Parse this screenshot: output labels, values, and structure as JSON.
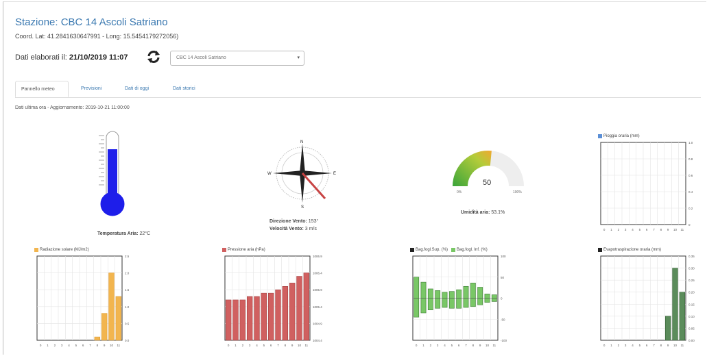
{
  "header": {
    "title": "Stazione: CBC 14 Ascoli Satriano",
    "coords": "Coord. Lat: 41.2841630647991 - Long: 15.5454179272056)",
    "dati_label": "Dati elaborati il:",
    "dati_value": "21/10/2019 11:07",
    "station_select": "CBC 14 Ascoli Satriano"
  },
  "tabs": [
    {
      "label": "Pannello meteo"
    },
    {
      "label": "Previsioni"
    },
    {
      "label": "Dati di oggi"
    },
    {
      "label": "Dati storici"
    }
  ],
  "updated_text": "Dati ultima ora - Aggiornamento: 2019-10-21 11:00:00",
  "widgets": {
    "temperature": {
      "label": "Temperatura Aria:",
      "value": "22°C"
    },
    "wind": {
      "dir_label": "Direzione Vento:",
      "dir_value": "153°",
      "speed_label": "Velocità Vento:",
      "speed_value": "3 m/s",
      "n": "N",
      "s": "S",
      "e": "E",
      "w": "W"
    },
    "humidity": {
      "label": "Umidità aria:",
      "value": "53.1%",
      "gauge_value": "50",
      "gauge_min": "0%",
      "gauge_max": "100%",
      "fill_fraction": 0.53
    }
  },
  "colors": {
    "thermo": "#1e1eea",
    "rad": "#f2b54f",
    "press": "#d06060",
    "soil": "#79c766",
    "evap": "#5b8c5b",
    "rain": "#5b8fd6"
  },
  "chart_data": [
    {
      "id": "rain",
      "type": "bar",
      "legend": "Pioggia oraria (mm)",
      "categories": [
        "0",
        "1",
        "2",
        "3",
        "4",
        "5",
        "6",
        "7",
        "8",
        "9",
        "10",
        "11"
      ],
      "values": [
        0,
        0,
        0,
        0,
        0,
        0,
        0,
        0,
        0,
        0,
        0,
        0
      ],
      "ylim": [
        0,
        1.0
      ],
      "yticks": [
        "1.0",
        "0.8",
        "0.6",
        "0.4",
        "0.2",
        "0"
      ]
    },
    {
      "id": "rad",
      "type": "bar",
      "legend": "Radiazione solare (MJ/m2)",
      "categories": [
        "0",
        "1",
        "2",
        "3",
        "4",
        "5",
        "6",
        "7",
        "8",
        "9",
        "10",
        "11"
      ],
      "values": [
        0,
        0,
        0,
        0,
        0,
        0,
        0,
        0,
        0.1,
        0.8,
        2.0,
        1.3
      ],
      "ylim": [
        0,
        2.5
      ],
      "yticks": [
        "2.5",
        "2.0",
        "1.5",
        "1.0",
        "0.5",
        "0.0"
      ]
    },
    {
      "id": "press",
      "type": "bar",
      "legend": "Pressione aria (hPa)",
      "categories": [
        "0",
        "1",
        "2",
        "3",
        "4",
        "5",
        "6",
        "7",
        "8",
        "9",
        "10",
        "11"
      ],
      "values": [
        1006.1,
        1006.1,
        1006.1,
        1006.2,
        1006.2,
        1006.3,
        1006.3,
        1006.4,
        1006.5,
        1006.6,
        1006.8,
        1006.9
      ],
      "ylim": [
        1004.9,
        1007.4
      ],
      "yticks": [
        "1006.9",
        "1006.4",
        "1005.9",
        "1005.4",
        "1004.9",
        "1004.4"
      ]
    },
    {
      "id": "soil",
      "type": "bar",
      "legend": [
        "Bag.fogl.Sup. (%)",
        "Bag.fogl. Inf. (%)"
      ],
      "categories": [
        "0",
        "1",
        "2",
        "3",
        "4",
        "5",
        "6",
        "7",
        "8",
        "9",
        "10",
        "11"
      ],
      "values_pos": [
        50,
        38,
        22,
        18,
        14,
        16,
        20,
        28,
        36,
        26,
        10,
        8
      ],
      "values_neg": [
        -45,
        -35,
        -28,
        -24,
        -22,
        -24,
        -24,
        -22,
        -20,
        -16,
        -10,
        -8
      ],
      "ylim": [
        -100,
        100
      ],
      "yticks": [
        "100",
        "50",
        "0",
        "-50",
        "-100"
      ]
    },
    {
      "id": "evap",
      "type": "bar",
      "legend": "Evapotraspirazione oraria (mm)",
      "categories": [
        "0",
        "1",
        "2",
        "3",
        "4",
        "5",
        "6",
        "7",
        "8",
        "9",
        "10",
        "11"
      ],
      "values": [
        0,
        0,
        0,
        0,
        0,
        0,
        0,
        0,
        0,
        0.1,
        0.3,
        0.2
      ],
      "ylim": [
        0,
        0.35
      ],
      "yticks": [
        "0.35",
        "0.30",
        "0.25",
        "0.20",
        "0.15",
        "0.10",
        "0.05",
        "0.00"
      ]
    }
  ]
}
